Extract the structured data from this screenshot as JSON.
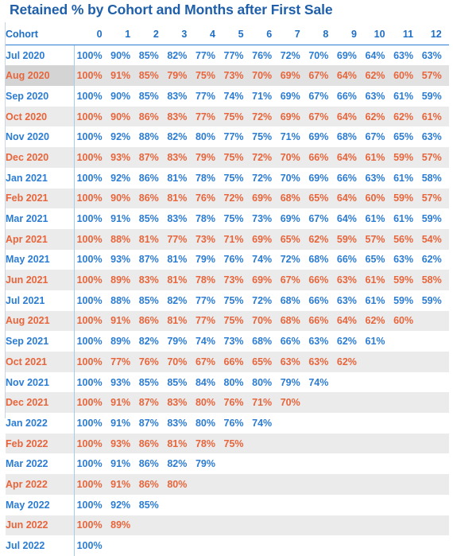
{
  "title": "Retained % by Cohort and Months after First Sale",
  "colors": {
    "title": "#1f5fa9",
    "blue_row": "#2b7cd3",
    "orange_row": "#e8653b",
    "header": "#1f6fc4",
    "band": "#ebebeb",
    "highlight": "#ffff00",
    "divider": "#a8cdeb"
  },
  "table": {
    "cohort_header": "Cohort",
    "month_headers": [
      "0",
      "1",
      "2",
      "3",
      "4",
      "5",
      "6",
      "7",
      "8",
      "9",
      "10",
      "11",
      "12"
    ],
    "highlighted_column_index": 8,
    "rows": [
      {
        "cohort": "Jul 2020",
        "color": "blue",
        "band": false,
        "values": [
          "100%",
          "90%",
          "85%",
          "82%",
          "77%",
          "77%",
          "76%",
          "72%",
          "70%",
          "69%",
          "64%",
          "63%",
          "63%"
        ]
      },
      {
        "cohort": "Aug 2020",
        "color": "orange",
        "band": true,
        "strong": true,
        "values": [
          "100%",
          "91%",
          "85%",
          "79%",
          "75%",
          "73%",
          "70%",
          "69%",
          "67%",
          "64%",
          "62%",
          "60%",
          "57%"
        ]
      },
      {
        "cohort": "Sep 2020",
        "color": "blue",
        "band": false,
        "values": [
          "100%",
          "90%",
          "85%",
          "83%",
          "77%",
          "74%",
          "71%",
          "69%",
          "67%",
          "66%",
          "63%",
          "61%",
          "59%"
        ]
      },
      {
        "cohort": "Oct 2020",
        "color": "orange",
        "band": true,
        "values": [
          "100%",
          "90%",
          "86%",
          "83%",
          "77%",
          "75%",
          "72%",
          "69%",
          "67%",
          "64%",
          "62%",
          "62%",
          "61%"
        ]
      },
      {
        "cohort": "Nov 2020",
        "color": "blue",
        "band": false,
        "values": [
          "100%",
          "92%",
          "88%",
          "82%",
          "80%",
          "77%",
          "75%",
          "71%",
          "69%",
          "68%",
          "67%",
          "65%",
          "63%"
        ]
      },
      {
        "cohort": "Dec 2020",
        "color": "orange",
        "band": true,
        "values": [
          "100%",
          "93%",
          "87%",
          "83%",
          "79%",
          "75%",
          "72%",
          "70%",
          "66%",
          "64%",
          "61%",
          "59%",
          "57%"
        ]
      },
      {
        "cohort": "Jan 2021",
        "color": "blue",
        "band": false,
        "values": [
          "100%",
          "92%",
          "86%",
          "81%",
          "78%",
          "75%",
          "72%",
          "70%",
          "69%",
          "66%",
          "63%",
          "61%",
          "58%"
        ]
      },
      {
        "cohort": "Feb 2021",
        "color": "orange",
        "band": true,
        "values": [
          "100%",
          "90%",
          "86%",
          "81%",
          "76%",
          "72%",
          "69%",
          "68%",
          "65%",
          "64%",
          "60%",
          "59%",
          "57%"
        ]
      },
      {
        "cohort": "Mar 2021",
        "color": "blue",
        "band": false,
        "values": [
          "100%",
          "91%",
          "85%",
          "83%",
          "78%",
          "75%",
          "73%",
          "69%",
          "67%",
          "64%",
          "61%",
          "61%",
          "59%"
        ]
      },
      {
        "cohort": "Apr 2021",
        "color": "orange",
        "band": true,
        "values": [
          "100%",
          "88%",
          "81%",
          "77%",
          "73%",
          "71%",
          "69%",
          "65%",
          "62%",
          "59%",
          "57%",
          "56%",
          "54%"
        ]
      },
      {
        "cohort": "May 2021",
        "color": "blue",
        "band": false,
        "values": [
          "100%",
          "93%",
          "87%",
          "81%",
          "79%",
          "76%",
          "74%",
          "72%",
          "68%",
          "66%",
          "65%",
          "63%",
          "62%"
        ]
      },
      {
        "cohort": "Jun 2021",
        "color": "orange",
        "band": true,
        "values": [
          "100%",
          "89%",
          "83%",
          "81%",
          "78%",
          "73%",
          "69%",
          "67%",
          "66%",
          "63%",
          "61%",
          "59%",
          "58%"
        ]
      },
      {
        "cohort": "Jul 2021",
        "color": "blue",
        "band": false,
        "values": [
          "100%",
          "88%",
          "85%",
          "82%",
          "77%",
          "75%",
          "72%",
          "68%",
          "66%",
          "63%",
          "61%",
          "59%",
          "59%"
        ]
      },
      {
        "cohort": "Aug 2021",
        "color": "orange",
        "band": true,
        "values": [
          "100%",
          "91%",
          "86%",
          "81%",
          "77%",
          "75%",
          "70%",
          "68%",
          "66%",
          "64%",
          "62%",
          "60%"
        ]
      },
      {
        "cohort": "Sep 2021",
        "color": "blue",
        "band": false,
        "values": [
          "100%",
          "89%",
          "82%",
          "79%",
          "74%",
          "73%",
          "68%",
          "66%",
          "63%",
          "62%",
          "61%"
        ]
      },
      {
        "cohort": "Oct 2021",
        "color": "orange",
        "band": true,
        "values": [
          "100%",
          "77%",
          "76%",
          "70%",
          "67%",
          "66%",
          "65%",
          "63%",
          "63%",
          "62%"
        ]
      },
      {
        "cohort": "Nov 2021",
        "color": "blue",
        "band": false,
        "values": [
          "100%",
          "93%",
          "85%",
          "85%",
          "84%",
          "80%",
          "80%",
          "79%",
          "74%"
        ]
      },
      {
        "cohort": "Dec 2021",
        "color": "orange",
        "band": true,
        "values": [
          "100%",
          "91%",
          "87%",
          "83%",
          "80%",
          "76%",
          "71%",
          "70%"
        ]
      },
      {
        "cohort": "Jan 2022",
        "color": "blue",
        "band": false,
        "values": [
          "100%",
          "91%",
          "87%",
          "83%",
          "80%",
          "76%",
          "74%"
        ]
      },
      {
        "cohort": "Feb 2022",
        "color": "orange",
        "band": true,
        "values": [
          "100%",
          "93%",
          "86%",
          "81%",
          "78%",
          "75%"
        ]
      },
      {
        "cohort": "Mar 2022",
        "color": "blue",
        "band": false,
        "values": [
          "100%",
          "91%",
          "86%",
          "82%",
          "79%"
        ]
      },
      {
        "cohort": "Apr 2022",
        "color": "orange",
        "band": true,
        "values": [
          "100%",
          "91%",
          "86%",
          "80%"
        ]
      },
      {
        "cohort": "May 2022",
        "color": "blue",
        "band": false,
        "values": [
          "100%",
          "92%",
          "85%"
        ]
      },
      {
        "cohort": "Jun 2022",
        "color": "orange",
        "band": true,
        "values": [
          "100%",
          "89%"
        ]
      },
      {
        "cohort": "Jul 2022",
        "color": "blue",
        "band": false,
        "values": [
          "100%"
        ]
      }
    ]
  },
  "chart_data": {
    "type": "table",
    "title": "Retained % by Cohort and Months after First Sale",
    "xlabel": "Months after First Sale",
    "ylabel": "Cohort",
    "categories": [
      "0",
      "1",
      "2",
      "3",
      "4",
      "5",
      "6",
      "7",
      "8",
      "9",
      "10",
      "11",
      "12"
    ],
    "series": [
      {
        "name": "Jul 2020",
        "values": [
          100,
          90,
          85,
          82,
          77,
          77,
          76,
          72,
          70,
          69,
          64,
          63,
          63
        ]
      },
      {
        "name": "Aug 2020",
        "values": [
          100,
          91,
          85,
          79,
          75,
          73,
          70,
          69,
          67,
          64,
          62,
          60,
          57
        ]
      },
      {
        "name": "Sep 2020",
        "values": [
          100,
          90,
          85,
          83,
          77,
          74,
          71,
          69,
          67,
          66,
          63,
          61,
          59
        ]
      },
      {
        "name": "Oct 2020",
        "values": [
          100,
          90,
          86,
          83,
          77,
          75,
          72,
          69,
          67,
          64,
          62,
          62,
          61
        ]
      },
      {
        "name": "Nov 2020",
        "values": [
          100,
          92,
          88,
          82,
          80,
          77,
          75,
          71,
          69,
          68,
          67,
          65,
          63
        ]
      },
      {
        "name": "Dec 2020",
        "values": [
          100,
          93,
          87,
          83,
          79,
          75,
          72,
          70,
          66,
          64,
          61,
          59,
          57
        ]
      },
      {
        "name": "Jan 2021",
        "values": [
          100,
          92,
          86,
          81,
          78,
          75,
          72,
          70,
          69,
          66,
          63,
          61,
          58
        ]
      },
      {
        "name": "Feb 2021",
        "values": [
          100,
          90,
          86,
          81,
          76,
          72,
          69,
          68,
          65,
          64,
          60,
          59,
          57
        ]
      },
      {
        "name": "Mar 2021",
        "values": [
          100,
          91,
          85,
          83,
          78,
          75,
          73,
          69,
          67,
          64,
          61,
          61,
          59
        ]
      },
      {
        "name": "Apr 2021",
        "values": [
          100,
          88,
          81,
          77,
          73,
          71,
          69,
          65,
          62,
          59,
          57,
          56,
          54
        ]
      },
      {
        "name": "May 2021",
        "values": [
          100,
          93,
          87,
          81,
          79,
          76,
          74,
          72,
          68,
          66,
          65,
          63,
          62
        ]
      },
      {
        "name": "Jun 2021",
        "values": [
          100,
          89,
          83,
          81,
          78,
          73,
          69,
          67,
          66,
          63,
          61,
          59,
          58
        ]
      },
      {
        "name": "Jul 2021",
        "values": [
          100,
          88,
          85,
          82,
          77,
          75,
          72,
          68,
          66,
          63,
          61,
          59,
          59
        ]
      },
      {
        "name": "Aug 2021",
        "values": [
          100,
          91,
          86,
          81,
          77,
          75,
          70,
          68,
          66,
          64,
          62,
          60
        ]
      },
      {
        "name": "Sep 2021",
        "values": [
          100,
          89,
          82,
          79,
          74,
          73,
          68,
          66,
          63,
          62,
          61
        ]
      },
      {
        "name": "Oct 2021",
        "values": [
          100,
          77,
          76,
          70,
          67,
          66,
          65,
          63,
          63,
          62
        ]
      },
      {
        "name": "Nov 2021",
        "values": [
          100,
          93,
          85,
          85,
          84,
          80,
          80,
          79,
          74
        ]
      },
      {
        "name": "Dec 2021",
        "values": [
          100,
          91,
          87,
          83,
          80,
          76,
          71,
          70
        ]
      },
      {
        "name": "Jan 2022",
        "values": [
          100,
          91,
          87,
          83,
          80,
          76,
          74
        ]
      },
      {
        "name": "Feb 2022",
        "values": [
          100,
          93,
          86,
          81,
          78,
          75
        ]
      },
      {
        "name": "Mar 2022",
        "values": [
          100,
          91,
          86,
          82,
          79
        ]
      },
      {
        "name": "Apr 2022",
        "values": [
          100,
          91,
          86,
          80
        ]
      },
      {
        "name": "May 2022",
        "values": [
          100,
          92,
          85
        ]
      },
      {
        "name": "Jun 2022",
        "values": [
          100,
          89
        ]
      },
      {
        "name": "Jul 2022",
        "values": [
          100
        ]
      }
    ],
    "highlighted_column": "8",
    "grid": false,
    "legend": "none"
  }
}
